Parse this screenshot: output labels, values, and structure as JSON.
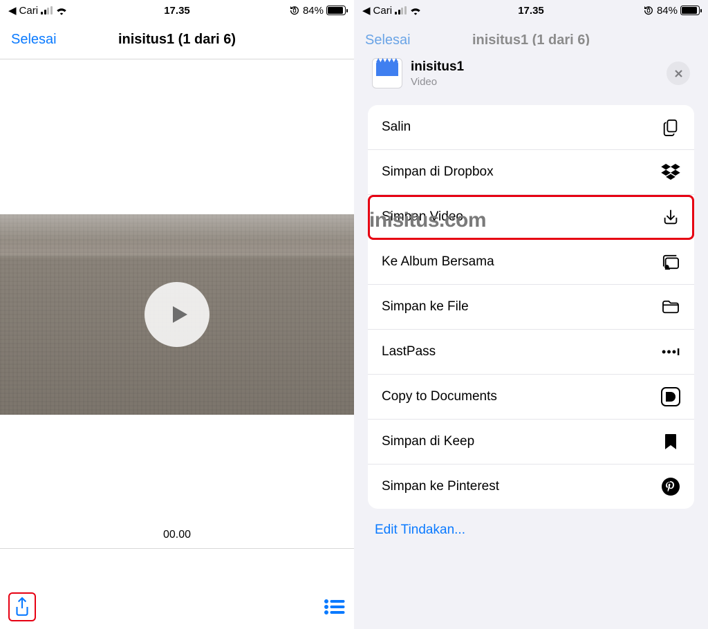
{
  "status": {
    "back_app": "Cari",
    "time": "17.35",
    "battery_pct": "84%"
  },
  "left": {
    "done": "Selesai",
    "title": "inisitus1 (1 dari 6)",
    "duration": "00.00"
  },
  "right_dim": {
    "done": "Selesai",
    "title": "inisitus1 (1 dari 6)"
  },
  "sheet": {
    "name": "inisitus1",
    "kind": "Video",
    "watermark": "inisitus.com",
    "actions": [
      {
        "label": "Salin",
        "icon": "copy-icon"
      },
      {
        "label": "Simpan di Dropbox",
        "icon": "dropbox-icon"
      },
      {
        "label": "Simpan Video",
        "icon": "download-icon",
        "highlight": true
      },
      {
        "label": "Ke Album Bersama",
        "icon": "shared-album-icon"
      },
      {
        "label": "Simpan ke File",
        "icon": "folder-icon"
      },
      {
        "label": "LastPass",
        "icon": "lastpass-icon"
      },
      {
        "label": "Copy to Documents",
        "icon": "documents-app-icon"
      },
      {
        "label": "Simpan di Keep",
        "icon": "bookmark-icon"
      },
      {
        "label": "Simpan ke Pinterest",
        "icon": "pinterest-icon"
      }
    ],
    "edit_link": "Edit Tindakan..."
  }
}
